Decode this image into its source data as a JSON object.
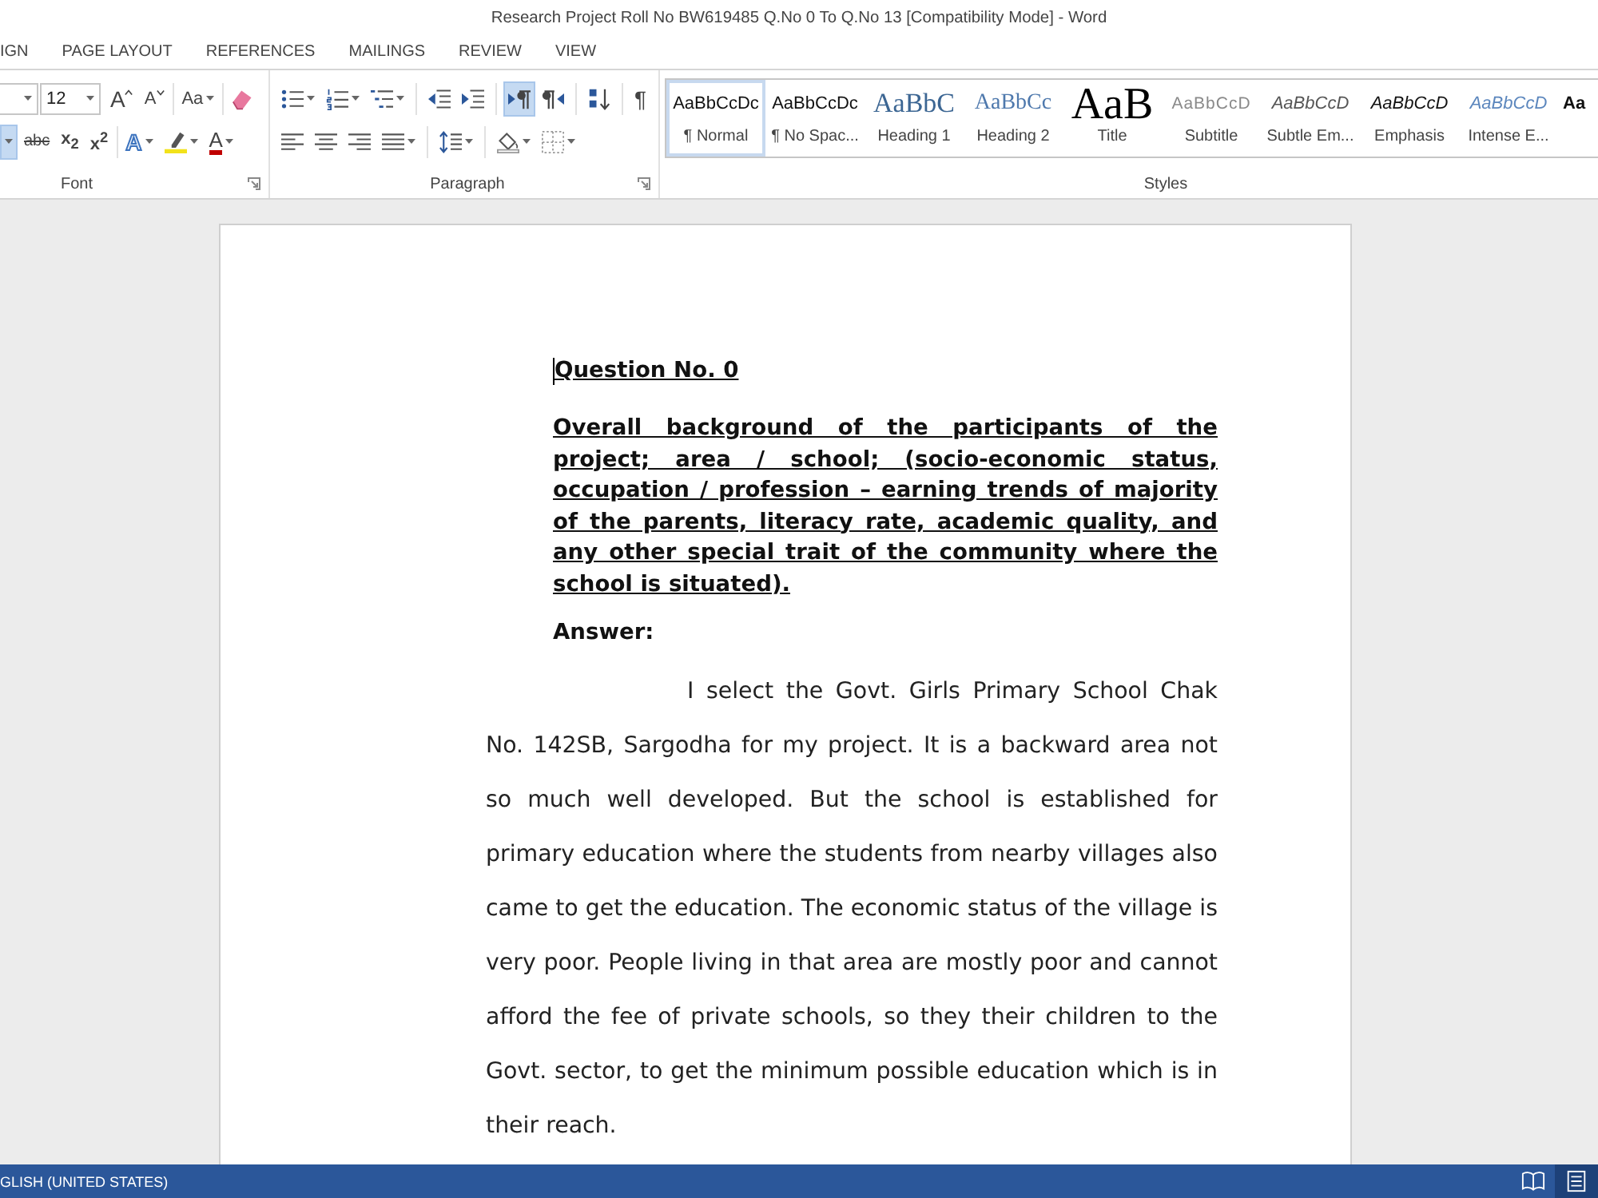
{
  "window": {
    "title": "Research Project Roll No BW619485 Q.No 0 To Q.No 13 [Compatibility Mode] - Word"
  },
  "ribbon_tabs": [
    {
      "label": "IGN",
      "selected": false
    },
    {
      "label": "PAGE LAYOUT",
      "selected": false
    },
    {
      "label": "REFERENCES",
      "selected": false
    },
    {
      "label": "MAILINGS",
      "selected": false
    },
    {
      "label": "REVIEW",
      "selected": false
    },
    {
      "label": "VIEW",
      "selected": false
    }
  ],
  "ribbon": {
    "groups": [
      {
        "kind": "font",
        "label": "Font",
        "launcher": true,
        "rows": [
          [
            [
              {
                "kind": "fontname",
                "dropdown": true
              },
              {
                "kind": "fontsize",
                "value": "12",
                "dropdown": true
              },
              {
                "kind": "grow",
                "text": "A",
                "dropdown": false,
                "pressed": false
              },
              {
                "kind": "shrink",
                "text": "A",
                "dropdown": false,
                "pressed": false
              }
            ],
            [
              {
                "kind": "case",
                "text": "Aa",
                "dropdown": true,
                "pressed": false
              }
            ],
            [
              {
                "kind": "eraser",
                "dropdown": false,
                "pressed": false
              }
            ]
          ],
          [
            [
              {
                "kind": "split",
                "dropdown": true,
                "pressed": true
              },
              {
                "kind": "strike",
                "text": "abc",
                "dropdown": false,
                "pressed": false
              },
              {
                "kind": "sub",
                "text": "x$_{2}$",
                "dropdown": false,
                "pressed": false
              },
              {
                "kind": "super",
                "text": "x$^{2}$",
                "dropdown": false,
                "pressed": false
              }
            ],
            [
              {
                "kind": "effects",
                "text": "A",
                "dropdown": true,
                "pressed": false
              },
              {
                "kind": "highlight",
                "dropdown": true,
                "pressed": false
              },
              {
                "kind": "fontcolor",
                "text": "A",
                "dropdown": true,
                "pressed": false
              }
            ]
          ]
        ]
      },
      {
        "kind": "paragraph",
        "label": "Paragraph",
        "launcher": true,
        "rows": [
          [
            [
              {
                "kind": "bullets",
                "dropdown": true,
                "pressed": false
              },
              {
                "kind": "numbering",
                "dropdown": true,
                "pressed": false
              },
              {
                "kind": "multilevel",
                "dropdown": true,
                "pressed": false
              }
            ],
            [
              {
                "kind": "outdent",
                "dropdown": false,
                "pressed": false
              },
              {
                "kind": "indent",
                "dropdown": false,
                "pressed": false
              }
            ],
            [
              {
                "kind": "ltr",
                "dropdown": false,
                "pressed": true
              },
              {
                "kind": "rtl",
                "dropdown": false,
                "pressed": false
              }
            ],
            [
              {
                "kind": "sort",
                "dropdown": false,
                "pressed": false
              }
            ],
            [
              {
                "kind": "pilcrow",
                "text": "¶",
                "dropdown": false,
                "pressed": false
              }
            ]
          ],
          [
            [
              {
                "kind": "left",
                "dropdown": false,
                "pressed": false
              },
              {
                "kind": "center",
                "dropdown": false,
                "pressed": false
              },
              {
                "kind": "right",
                "dropdown": false,
                "pressed": false
              },
              {
                "kind": "justify",
                "dropdown": true,
                "pressed": false
              }
            ],
            [
              {
                "kind": "spacing",
                "dropdown": true,
                "pressed": false
              }
            ],
            [
              {
                "kind": "shading",
                "dropdown": true,
                "pressed": false
              },
              {
                "kind": "borders",
                "dropdown": true,
                "pressed": false
              }
            ]
          ]
        ]
      },
      {
        "kind": "styles",
        "label": "Styles",
        "launcher": false,
        "styles": [
          {
            "kind": "normal",
            "preview": "AaBbCcDc",
            "name": "¶ Normal",
            "selected": true
          },
          {
            "kind": "nospacing",
            "preview": "AaBbCcDc",
            "name": "¶ No Spac...",
            "selected": false
          },
          {
            "kind": "heading1",
            "preview": "AaBbC",
            "name": "Heading 1",
            "selected": false
          },
          {
            "kind": "heading2",
            "preview": "AaBbCc",
            "name": "Heading 2",
            "selected": false
          },
          {
            "kind": "title",
            "preview": "AaB",
            "name": "Title",
            "selected": false
          },
          {
            "kind": "subtitle",
            "preview": "AaBbCcD",
            "name": "Subtitle",
            "selected": false
          },
          {
            "kind": "subtle",
            "preview": "AaBbCcD",
            "name": "Subtle Em...",
            "selected": false
          },
          {
            "kind": "emphasis",
            "preview": "AaBbCcD",
            "name": "Emphasis",
            "selected": false
          },
          {
            "kind": "intense",
            "preview": "AaBbCcD",
            "name": "Intense E...",
            "selected": false
          },
          {
            "kind": "strong",
            "preview": "Aa",
            "selected": false
          }
        ]
      }
    ]
  },
  "document": {
    "blocks": [
      {
        "kind": "heading",
        "text": "Question No. 0",
        "cursor": true
      },
      {
        "kind": "question",
        "text": "Overall background of the participants of the project; area / school; (socio-economic status, occupation / profession – earning trends of majority of the parents, literacy rate, academic quality, and any other special trait of the community where the school is situated).",
        "cursor": false
      },
      {
        "kind": "label",
        "text": "Answer:",
        "cursor": false
      },
      {
        "kind": "body",
        "text": "I select the Govt. Girls Primary School Chak No. 142SB, Sargodha for my project. It is a backward area not so much well developed. But the school is established for primary education where the students from nearby villages also came to get the education. The economic status of the village is very poor. People living in that area are mostly poor and cannot afford the fee of private schools, so they their children to the Govt. sector, to get the minimum possible education which is in their reach.",
        "cursor": false
      }
    ]
  },
  "status_bar": {
    "language": "GLISH (UNITED STATES)",
    "views": [
      {
        "kind": "read",
        "selected": false
      },
      {
        "kind": "print",
        "selected": true
      }
    ]
  }
}
